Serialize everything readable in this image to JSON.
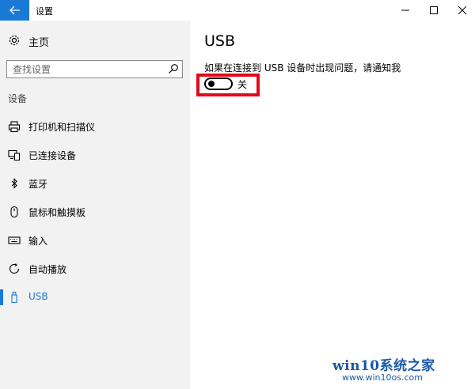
{
  "window": {
    "title": "设置"
  },
  "sidebar": {
    "home_label": "主页",
    "search_placeholder": "查找设置",
    "section_label": "设备",
    "items": [
      {
        "label": "打印机和扫描仪",
        "icon": "printer-icon",
        "active": false
      },
      {
        "label": "已连接设备",
        "icon": "connected-devices-icon",
        "active": false
      },
      {
        "label": "蓝牙",
        "icon": "bluetooth-icon",
        "active": false
      },
      {
        "label": "鼠标和触摸板",
        "icon": "mouse-icon",
        "active": false
      },
      {
        "label": "输入",
        "icon": "keyboard-icon",
        "active": false
      },
      {
        "label": "自动播放",
        "icon": "autoplay-icon",
        "active": false
      },
      {
        "label": "USB",
        "icon": "usb-icon",
        "active": true
      }
    ]
  },
  "main": {
    "title": "USB",
    "notify_description": "如果在连接到 USB 设备时出现问题，请通知我",
    "toggle": {
      "state_label": "关",
      "on": false
    }
  },
  "watermark": {
    "text": "win10系统之家",
    "url": "www.win10os.com"
  },
  "colors": {
    "accent": "#1979d7",
    "sidebar_bg": "#f2f2f2",
    "highlight": "#e00b1b",
    "watermark": "#1a5aa6"
  }
}
